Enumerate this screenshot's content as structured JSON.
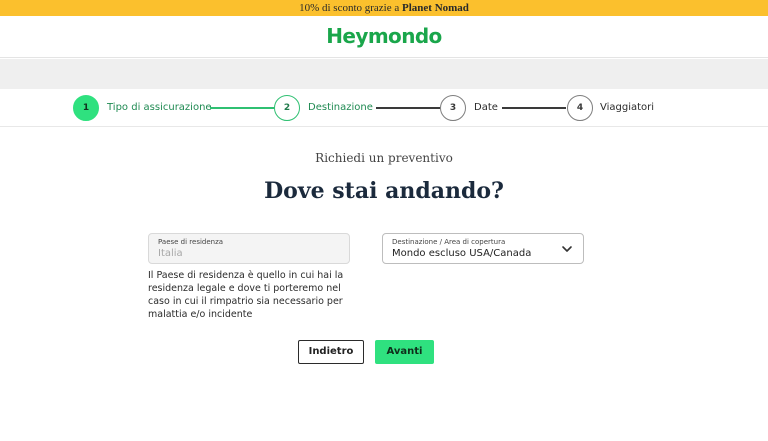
{
  "promo": {
    "text_before": "10% di sconto grazie a ",
    "brand": "Planet Nomad"
  },
  "header": {
    "logo": "Heymondo"
  },
  "stepper": {
    "steps": [
      {
        "number": "1",
        "label": "Tipo di assicurazione",
        "state": "done"
      },
      {
        "number": "2",
        "label": "Destinazione",
        "state": "active"
      },
      {
        "number": "3",
        "label": "Date",
        "state": "todo"
      },
      {
        "number": "4",
        "label": "Viaggiatori",
        "state": "todo"
      }
    ]
  },
  "main": {
    "subtitle": "Richiedi un preventivo",
    "title": "Dove stai andando?",
    "residence": {
      "label": "Paese di residenza",
      "value": "Italia"
    },
    "destination": {
      "label": "Destinazione / Area di copertura",
      "value": "Mondo escluso USA/Canada",
      "icon": "chevron-down-icon"
    },
    "helper": "Il Paese di residenza è quello in cui hai la residenza legale e dove ti porteremo nel caso in cui il rimpatrio sia necessario per malattia e/o incidente",
    "back_label": "Indietro",
    "next_label": "Avanti"
  },
  "colors": {
    "accent": "#2fe17f",
    "promo_bg": "#fbc02d",
    "logo": "#1aa64b"
  }
}
